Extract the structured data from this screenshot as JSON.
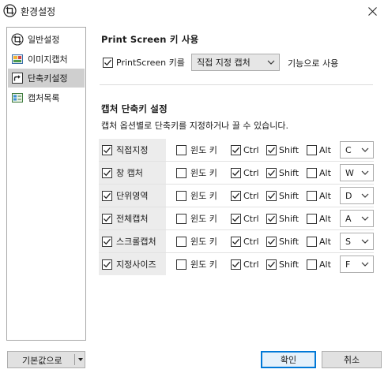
{
  "window": {
    "title": "환경설정"
  },
  "sidebar": {
    "items": [
      {
        "label": "일반설정",
        "icon": "crop-capture-icon",
        "selected": false
      },
      {
        "label": "이미지캡처",
        "icon": "image-capture-icon",
        "selected": false
      },
      {
        "label": "단축키설정",
        "icon": "shortcut-arrow-icon",
        "selected": true
      },
      {
        "label": "캡처목록",
        "icon": "capture-list-icon",
        "selected": false
      }
    ]
  },
  "printscreen": {
    "title": "Print Screen 키 사용",
    "checkbox_label": "PrintScreen 키를",
    "checked": true,
    "action_value": "직접 지정 캡처",
    "suffix": "기능으로 사용"
  },
  "shortcuts": {
    "title": "캡처 단축키 설정",
    "description": "캡처 옵션별로 단축키를 지정하거나 끌 수 있습니다.",
    "modifier_labels": {
      "win": "윈도 키",
      "ctrl": "Ctrl",
      "shift": "Shift",
      "alt": "Alt"
    },
    "rows": [
      {
        "name": "직접지정",
        "enabled": true,
        "win": false,
        "ctrl": true,
        "shift": true,
        "alt": false,
        "key": "C"
      },
      {
        "name": "창 캡처",
        "enabled": true,
        "win": false,
        "ctrl": true,
        "shift": true,
        "alt": false,
        "key": "W"
      },
      {
        "name": "단위영역",
        "enabled": true,
        "win": false,
        "ctrl": true,
        "shift": true,
        "alt": false,
        "key": "D"
      },
      {
        "name": "전체캡처",
        "enabled": true,
        "win": false,
        "ctrl": true,
        "shift": true,
        "alt": false,
        "key": "A"
      },
      {
        "name": "스크롤캡처",
        "enabled": true,
        "win": false,
        "ctrl": true,
        "shift": true,
        "alt": false,
        "key": "S"
      },
      {
        "name": "지정사이즈",
        "enabled": true,
        "win": false,
        "ctrl": true,
        "shift": true,
        "alt": false,
        "key": "F"
      }
    ]
  },
  "footer": {
    "defaults_label": "기본값으로",
    "ok_label": "확인",
    "cancel_label": "취소"
  },
  "colors": {
    "accent": "#0078d7",
    "selected_bg": "#cfcfcf",
    "row_label_bg": "#ececec"
  }
}
